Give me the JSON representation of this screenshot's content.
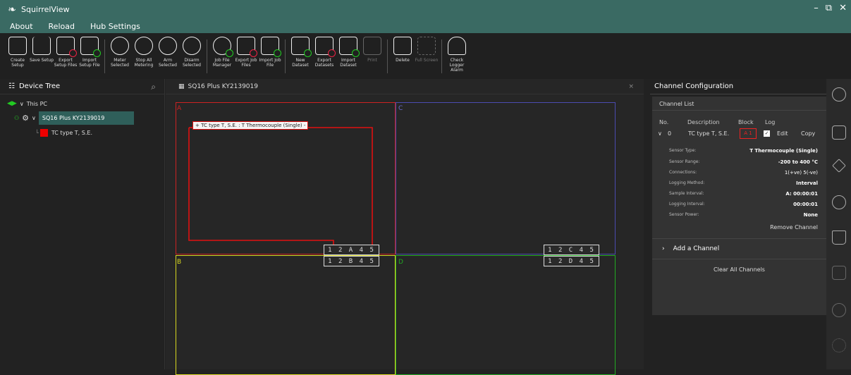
{
  "app": {
    "title": "SquirrelView",
    "logo_icon": "squirrel-icon"
  },
  "menu": [
    "About",
    "Reload",
    "Hub Settings"
  ],
  "toolbar": [
    {
      "label": "Create Setup",
      "icon": "create-setup-icon"
    },
    {
      "label": "Save Setup",
      "icon": "save-setup-icon"
    },
    {
      "label": "Export Setup Files",
      "icon": "export-setup-icon"
    },
    {
      "label": "Import Setup File",
      "icon": "import-setup-icon"
    },
    {
      "label": "Meter Selected",
      "icon": "meter-icon"
    },
    {
      "label": "Stop All Metering",
      "icon": "stop-metering-icon"
    },
    {
      "label": "Arm Selected",
      "icon": "arm-icon"
    },
    {
      "label": "Disarm Selected",
      "icon": "disarm-icon"
    },
    {
      "label": "Job File Manager",
      "icon": "job-file-manager-icon"
    },
    {
      "label": "Export Job Files",
      "icon": "export-job-icon"
    },
    {
      "label": "Import Job File",
      "icon": "import-job-icon"
    },
    {
      "label": "New Dataset",
      "icon": "new-dataset-icon"
    },
    {
      "label": "Export Datasets",
      "icon": "export-dataset-icon"
    },
    {
      "label": "Import Dataset",
      "icon": "import-dataset-icon"
    },
    {
      "label": "Print",
      "icon": "print-icon",
      "disabled": true
    },
    {
      "label": "Delete",
      "icon": "delete-icon"
    },
    {
      "label": "Full Screen",
      "icon": "fullscreen-icon",
      "disabled": true
    },
    {
      "label": "Check Logger Alarm",
      "icon": "bell-icon"
    }
  ],
  "device_tree": {
    "title": "Device Tree",
    "this_pc": "This PC",
    "device": "SQ16 Plus KY2139019",
    "channel": "TC type T, S.E."
  },
  "tab": {
    "title": "SQ16 Plus KY2139019"
  },
  "quadrants": {
    "A": {
      "label": "A",
      "color": "#cc2222"
    },
    "B": {
      "label": "B",
      "color": "#d8d820"
    },
    "C": {
      "label": "C",
      "color": "#4b4bb0"
    },
    "D": {
      "label": "D",
      "color": "#22aa22"
    }
  },
  "blocks": {
    "a": "1 2 A 4 5",
    "b": "1 2 B 4 5",
    "c": "1 2 C 4 5",
    "d": "1 2 D 4 5"
  },
  "channel_box_label": "+  TC type T, S.E. : T Thermocouple (Single)  -",
  "config": {
    "title": "Channel Configuration",
    "list_title": "Channel List",
    "headers": {
      "no": "No.",
      "description": "Description",
      "block": "Block",
      "log": "Log"
    },
    "row": {
      "no": "0",
      "description": "TC type T, S.E.",
      "block": "A 1",
      "edit": "Edit",
      "copy": "Copy"
    },
    "details": [
      {
        "k": "Sensor Type:",
        "v": "T Thermocouple (Single)"
      },
      {
        "k": "Sensor Range:",
        "v": "-200 to 400 °C"
      },
      {
        "k": "Connections:",
        "v": "1(+ve)  5(-ve)"
      },
      {
        "k": "Logging Method:",
        "v": "Interval"
      },
      {
        "k": "Sample Interval:",
        "v": "A: 00:00:01"
      },
      {
        "k": "Logging Interval:",
        "v": "00:00:01"
      },
      {
        "k": "Sensor Power:",
        "v": "None"
      }
    ],
    "remove": "Remove Channel",
    "add": "Add a Channel",
    "clear": "Clear All Channels"
  }
}
